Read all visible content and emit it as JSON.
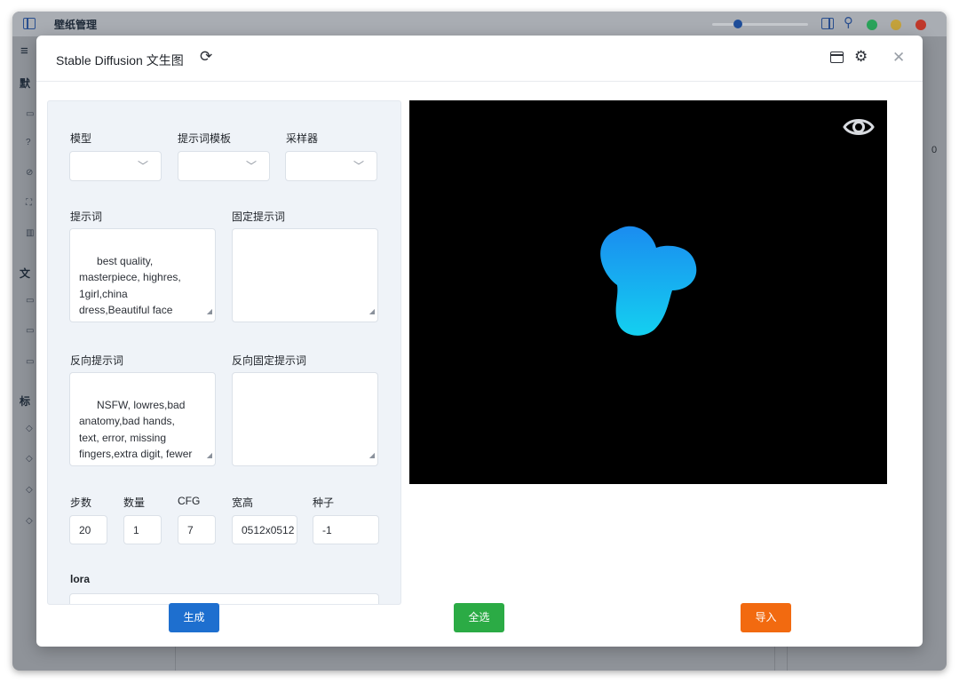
{
  "app": {
    "title": "壁纸管理",
    "sidebar": {
      "menu_glyph": "≡",
      "section_default": "默",
      "section_files": "文",
      "section_tags": "标"
    },
    "background_value": "0",
    "accent_color": "#1f4e9a"
  },
  "dialog": {
    "title": "Stable Diffusion 文生图",
    "refresh_icon": "refresh-icon",
    "close_glyph": "✕"
  },
  "form": {
    "model_label": "模型",
    "model_value": "",
    "prompt_template_label": "提示词模板",
    "prompt_template_value": "",
    "sampler_label": "采样器",
    "sampler_value": "",
    "prompt_label": "提示词",
    "prompt_value": "best quality,\nmasterpiece, highres,\n1girl,china\ndress,Beautiful face",
    "fixed_prompt_label": "固定提示词",
    "fixed_prompt_value": "",
    "negative_prompt_label": "反向提示词",
    "negative_prompt_value": "NSFW, lowres,bad\nanatomy,bad hands,\ntext, error, missing\nfingers,extra digit, fewer\ndigits, cropped,\nworst quality, low",
    "negative_fixed_prompt_label": "反向固定提示词",
    "negative_fixed_prompt_value": "",
    "steps_label": "步数",
    "steps_value": "20",
    "count_label": "数量",
    "count_value": "1",
    "cfg_label": "CFG",
    "cfg_value": "7",
    "size_label": "宽高",
    "size_value": "0512x0512",
    "seed_label": "种子",
    "seed_value": "-1",
    "lora_label": "lora"
  },
  "actions": {
    "generate_label": "生成",
    "select_all_label": "全选",
    "import_label": "导入",
    "generate_color": "#1e6fcf",
    "select_all_color": "#2bab45",
    "import_color": "#f26a10"
  }
}
